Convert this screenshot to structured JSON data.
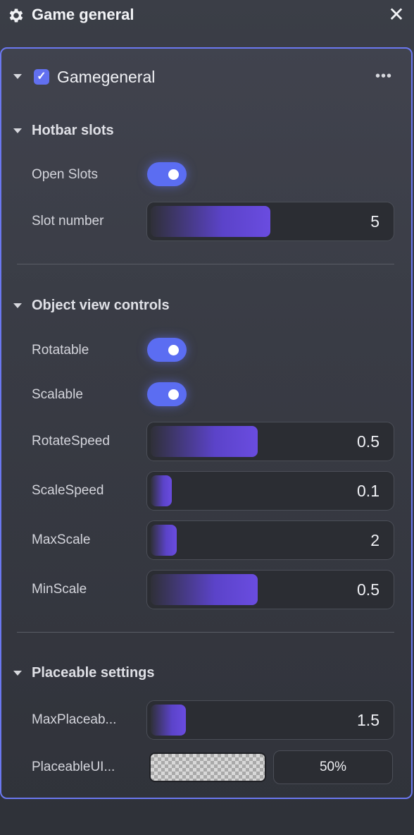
{
  "window": {
    "title": "Game general",
    "settings_icon": "gear-icon",
    "close_icon": "close-icon",
    "close_glyph": "✕"
  },
  "component": {
    "enabled": true,
    "title": "Gamegeneral",
    "more_glyph": "•••"
  },
  "hotbar": {
    "title": "Hotbar slots",
    "open_slots": {
      "label": "Open Slots",
      "on": true
    },
    "slot_number": {
      "label": "Slot number",
      "value": "5",
      "fill_fraction": 0.5
    }
  },
  "object_view": {
    "title": "Object view controls",
    "rotatable": {
      "label": "Rotatable",
      "on": true
    },
    "scalable": {
      "label": "Scalable",
      "on": true
    },
    "rotate_speed": {
      "label": "RotateSpeed",
      "value": "0.5",
      "fill_fraction": 0.44
    },
    "scale_speed": {
      "label": "ScaleSpeed",
      "value": "0.1",
      "fill_fraction": 0.08
    },
    "max_scale": {
      "label": "MaxScale",
      "value": "2",
      "fill_fraction": 0.1
    },
    "min_scale": {
      "label": "MinScale",
      "value": "0.5",
      "fill_fraction": 0.44
    }
  },
  "placeable": {
    "title": "Placeable settings",
    "max_placeable": {
      "label": "MaxPlaceab...",
      "value": "1.5",
      "fill_fraction": 0.14
    },
    "placeable_ui": {
      "label": "PlaceableUI...",
      "opacity": "50%"
    }
  },
  "colors": {
    "accent": "#5b6df2",
    "panel_border": "#6b78f0",
    "slider_fill": "#6a4ce0"
  }
}
